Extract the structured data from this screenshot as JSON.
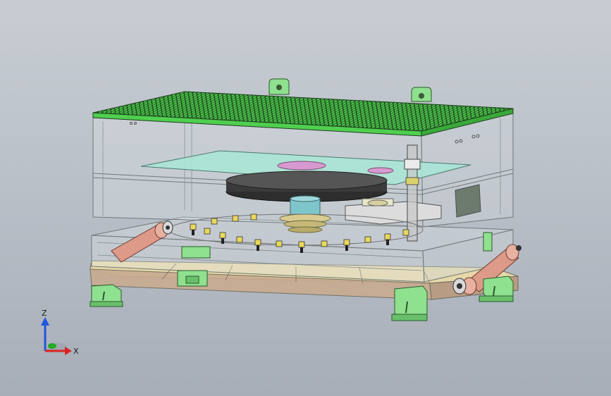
{
  "viewport": {
    "background_top": "#c8cdd3",
    "background_bottom": "#a7aeb8"
  },
  "model": {
    "colors": {
      "top_plate": "#3fbf3f",
      "grid_line": "#1a3a1a",
      "frame_line": "#6f7a7a",
      "green_part": "#8fe08f",
      "cyan_plate": "#9fe0d0",
      "pink_disc": "#d79ad0",
      "dark_disc": "#3a3a3a",
      "shaft": "#6fb7c0",
      "base_plate": "#d9c9a0",
      "cylinder": "#d99080",
      "gray_block": "#d8d8d8"
    },
    "icons": [
      "mounting-foot-icon",
      "lifting-lug-icon",
      "hydraulic-cylinder-icon"
    ]
  },
  "triad": {
    "z_label": "Z",
    "x_label": "X",
    "z_color": "#2255dd",
    "x_color": "#dd2222",
    "y_color": "#22aa22"
  }
}
